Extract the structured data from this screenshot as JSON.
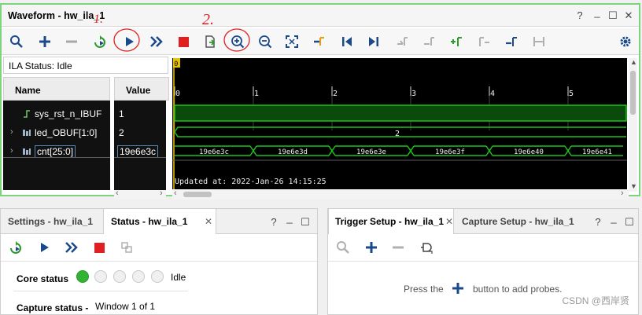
{
  "waveform": {
    "title": "Waveform - hw_ila_1",
    "window_controls": [
      "?",
      "_",
      "☐",
      "✕"
    ],
    "ila_status": "ILA Status: Idle",
    "columns": {
      "name": "Name",
      "value": "Value"
    },
    "signals": [
      {
        "name": "sys_rst_n_IBUF",
        "value": "1",
        "expandable": false
      },
      {
        "name": "led_OBUF[1:0]",
        "value": "2",
        "expandable": true
      },
      {
        "name": "cnt[25:0]",
        "value": "19e6e3c",
        "expandable": true
      }
    ],
    "ruler_ticks": [
      "0",
      "1",
      "2",
      "3",
      "4",
      "5"
    ],
    "marker_label": "0",
    "led_bus_label": "2",
    "cnt_bus_values": [
      "19e6e3c",
      "19e6e3d",
      "19e6e3e",
      "19e6e3f",
      "19e6e40",
      "19e6e41"
    ],
    "updated_text": "Updated at: 2022-Jan-26 14:15:25",
    "annotations": [
      "1.",
      "2."
    ]
  },
  "settings_panel": {
    "tabs": [
      {
        "label": "Settings - hw_ila_1",
        "active": false
      },
      {
        "label": "Status - hw_ila_1",
        "active": true
      }
    ],
    "window_controls": [
      "?",
      "_",
      "☐"
    ],
    "core_status_label": "Core status",
    "core_status_text": "Idle",
    "capture_status_label": "Capture status -",
    "capture_status_value": "Window 1 of 1"
  },
  "trigger_panel": {
    "tabs": [
      {
        "label": "Trigger Setup - hw_ila_1",
        "active": true
      },
      {
        "label": "Capture Setup - hw_ila_1",
        "active": false
      }
    ],
    "window_controls": [
      "?",
      "_",
      "☐"
    ],
    "hint_before": "Press the",
    "hint_after": "button to add probes."
  },
  "watermark": "CSDN @西岸贤",
  "colors": {
    "accent_green": "#7ed37e",
    "wave_green": "#1bc41b",
    "stop_red": "#e02020",
    "icon_blue": "#1a4a8a"
  }
}
